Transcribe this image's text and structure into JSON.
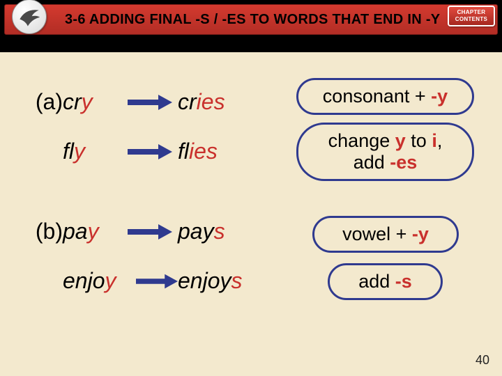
{
  "header": {
    "title": "3-6  ADDING FINAL -S / -ES TO WORDS THAT END IN -Y",
    "chapter_btn_line1": "CHAPTER",
    "chapter_btn_line2": "CONTENTS"
  },
  "rows": {
    "a": {
      "label": "(a)",
      "word1_base": "cr",
      "word1_y": "y",
      "result1_base": "cr",
      "result1_i": "i",
      "result1_es": "es",
      "word2_base": "fl",
      "word2_y": "y",
      "result2_base": "fl",
      "result2_i": "i",
      "result2_es": "es"
    },
    "b": {
      "label": "(b)",
      "word1_base": "pa",
      "word1_y": "y",
      "result1_base": "pay",
      "result1_s": "s",
      "word2_base": "enjo",
      "word2_y": "y",
      "result2_base": "enjoy",
      "result2_s": "s"
    }
  },
  "callouts": {
    "c1_pre": "consonant + ",
    "c1_y": "-y",
    "c2_l1a": "change ",
    "c2_l1_y": "y",
    "c2_l1b": " to ",
    "c2_l1_i": "i",
    "c2_l1c": ",",
    "c2_l2a": "add ",
    "c2_l2_es": "-es",
    "c3_pre": "vowel + ",
    "c3_y": "-y",
    "c4_pre": "add ",
    "c4_s": "-s"
  },
  "page_number": "40",
  "colors": {
    "accent": "#c9302c",
    "callout_border": "#2f3a8f",
    "header_red": "#c8362d"
  }
}
